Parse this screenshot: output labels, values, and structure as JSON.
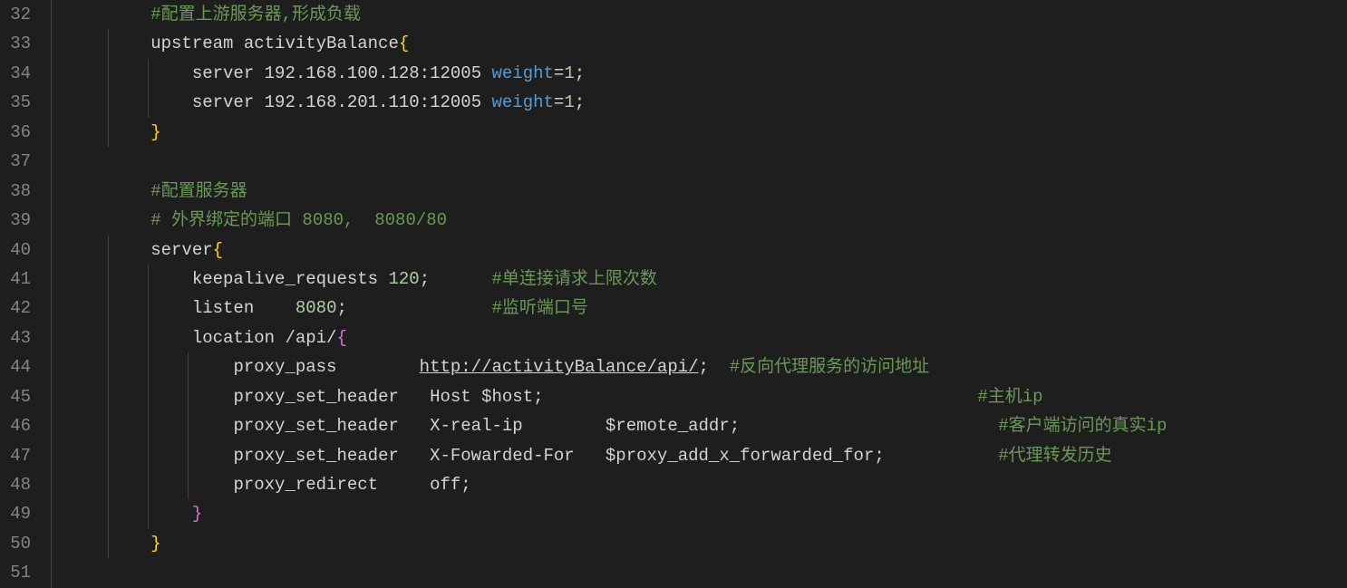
{
  "lineStart": 32,
  "lineEnd": 51,
  "lines": {
    "32": {
      "indent": 2,
      "tokens": [
        {
          "t": "#配置上游服务器,形成负载",
          "cls": "c"
        }
      ]
    },
    "33": {
      "indent": 2,
      "tokens": [
        {
          "t": "upstream activityBalance",
          "cls": "p"
        },
        {
          "t": "{",
          "cls": "br"
        }
      ]
    },
    "34": {
      "indent": 3,
      "tokens": [
        {
          "t": "server ",
          "cls": "p"
        },
        {
          "t": "192.168.100.128:12005 ",
          "cls": "p"
        },
        {
          "t": "weight",
          "cls": "k"
        },
        {
          "t": "=",
          "cls": "p"
        },
        {
          "t": "1",
          "cls": "n"
        },
        {
          "t": ";",
          "cls": "p"
        }
      ]
    },
    "35": {
      "indent": 3,
      "tokens": [
        {
          "t": "server ",
          "cls": "p"
        },
        {
          "t": "192.168.201.110:12005 ",
          "cls": "p"
        },
        {
          "t": "weight",
          "cls": "k"
        },
        {
          "t": "=",
          "cls": "p"
        },
        {
          "t": "1",
          "cls": "n"
        },
        {
          "t": ";",
          "cls": "p"
        }
      ]
    },
    "36": {
      "indent": 2,
      "tokens": [
        {
          "t": "}",
          "cls": "br"
        }
      ]
    },
    "37": {
      "indent": 0,
      "tokens": []
    },
    "38": {
      "indent": 2,
      "tokens": [
        {
          "t": "#配置服务器",
          "cls": "c"
        }
      ]
    },
    "39": {
      "indent": 2,
      "tokens": [
        {
          "t": "# 外界绑定的端口 8080,  8080/80",
          "cls": "c"
        }
      ]
    },
    "40": {
      "indent": 2,
      "tokens": [
        {
          "t": "server",
          "cls": "p"
        },
        {
          "t": "{",
          "cls": "br"
        }
      ]
    },
    "41": {
      "indent": 3,
      "tokens": [
        {
          "t": "keepalive_requests ",
          "cls": "p"
        },
        {
          "t": "120",
          "cls": "n"
        },
        {
          "t": ";      ",
          "cls": "p"
        },
        {
          "t": "#单连接请求上限次数",
          "cls": "c"
        }
      ]
    },
    "42": {
      "indent": 3,
      "tokens": [
        {
          "t": "listen    ",
          "cls": "p"
        },
        {
          "t": "8080",
          "cls": "n"
        },
        {
          "t": ";              ",
          "cls": "p"
        },
        {
          "t": "#监听端口号",
          "cls": "c"
        }
      ]
    },
    "43": {
      "indent": 3,
      "tokens": [
        {
          "t": "location /api/",
          "cls": "p"
        },
        {
          "t": "{",
          "cls": "br2"
        }
      ]
    },
    "44": {
      "indent": 4,
      "tokens": [
        {
          "t": "proxy_pass        ",
          "cls": "p"
        },
        {
          "t": "http://activityBalance/api/",
          "cls": "url"
        },
        {
          "t": ";  ",
          "cls": "p"
        },
        {
          "t": "#反向代理服务的访问地址",
          "cls": "c"
        }
      ]
    },
    "45": {
      "indent": 4,
      "tokens": [
        {
          "t": "proxy_set_header   Host $host;                                          ",
          "cls": "p"
        },
        {
          "t": "#主机ip",
          "cls": "c"
        }
      ]
    },
    "46": {
      "indent": 4,
      "tokens": [
        {
          "t": "proxy_set_header   X-real-ip        $remote_addr;                         ",
          "cls": "p"
        },
        {
          "t": "#客户端访问的真实ip",
          "cls": "c"
        }
      ]
    },
    "47": {
      "indent": 4,
      "tokens": [
        {
          "t": "proxy_set_header   X-Fowarded-For   $proxy_add_x_forwarded_for;           ",
          "cls": "p"
        },
        {
          "t": "#代理转发历史",
          "cls": "c"
        }
      ]
    },
    "48": {
      "indent": 4,
      "tokens": [
        {
          "t": "proxy_redirect     off;",
          "cls": "p"
        }
      ]
    },
    "49": {
      "indent": 3,
      "tokens": [
        {
          "t": "}",
          "cls": "br2"
        }
      ]
    },
    "50": {
      "indent": 2,
      "tokens": [
        {
          "t": "}",
          "cls": "br"
        }
      ]
    },
    "51": {
      "indent": 0,
      "tokens": []
    }
  },
  "indentUnit": "    ",
  "indentWidth": 44,
  "indentGuides": {
    "33": [
      1
    ],
    "34": [
      1,
      2
    ],
    "35": [
      1,
      2
    ],
    "36": [
      1
    ],
    "40": [
      1
    ],
    "41": [
      1,
      2
    ],
    "42": [
      1,
      2
    ],
    "43": [
      1,
      2
    ],
    "44": [
      1,
      2,
      3
    ],
    "45": [
      1,
      2,
      3
    ],
    "46": [
      1,
      2,
      3
    ],
    "47": [
      1,
      2,
      3
    ],
    "48": [
      1,
      2,
      3
    ],
    "49": [
      1,
      2
    ],
    "50": [
      1
    ]
  }
}
